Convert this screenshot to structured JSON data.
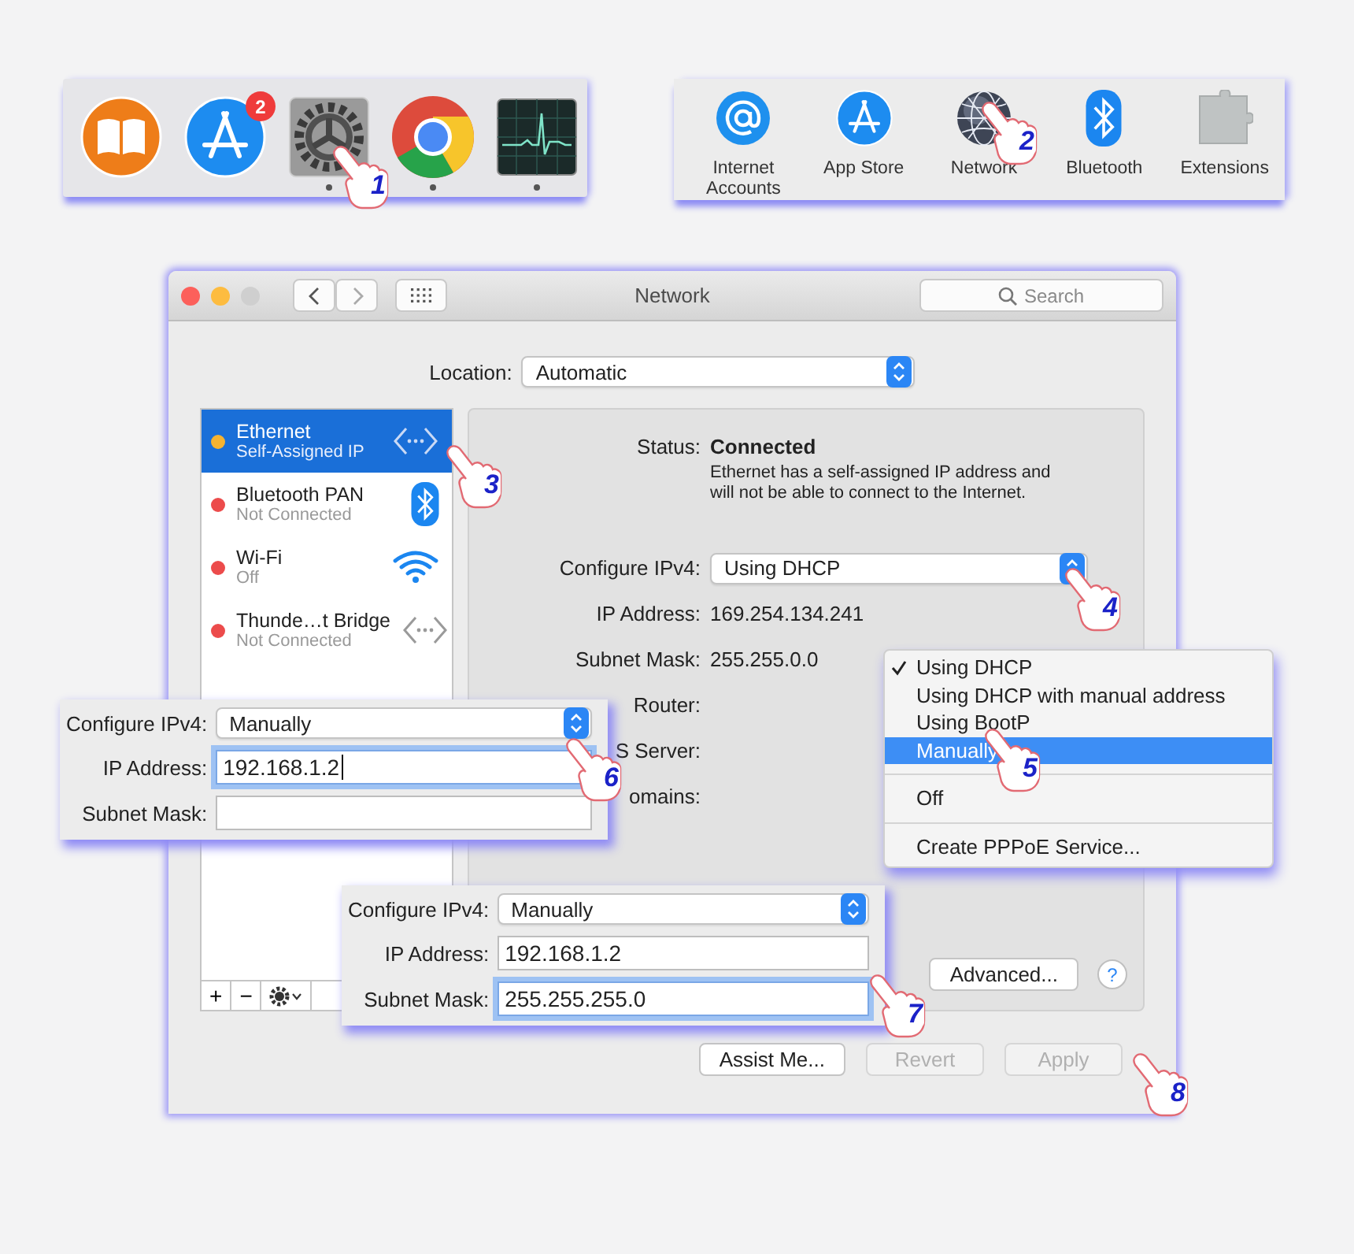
{
  "dock": {
    "items": [
      {
        "kind": "books"
      },
      {
        "kind": "store",
        "badge": "2"
      },
      {
        "kind": "settings",
        "running": true
      },
      {
        "kind": "browser",
        "running": true
      },
      {
        "kind": "monitor",
        "running": true
      }
    ]
  },
  "preferences": {
    "items": [
      {
        "kind": "accounts",
        "label": "Internet Accounts"
      },
      {
        "kind": "store",
        "label": "App Store"
      },
      {
        "kind": "network",
        "label": "Network"
      },
      {
        "kind": "bluetooth",
        "label": "Bluetooth"
      },
      {
        "kind": "extensions",
        "label": "Extensions"
      }
    ]
  },
  "window": {
    "title": "Network",
    "search": {
      "placeholder": "Search"
    },
    "location": {
      "label": "Location:",
      "value": "Automatic"
    }
  },
  "services": [
    {
      "name": "Ethernet",
      "status": "Self-Assigned IP",
      "color": "#f5b331",
      "kind": "ethernet",
      "selected": true
    },
    {
      "name": "Bluetooth PAN",
      "status": "Not Connected",
      "color": "#ec4b4b",
      "kind": "bluetooth",
      "selected": false
    },
    {
      "name": "Wi-Fi",
      "status": "Off",
      "color": "#ec4b4b",
      "kind": "wifi",
      "selected": false
    },
    {
      "name": "Thunde…t Bridge",
      "status": "Not Connected",
      "color": "#ec4b4b",
      "kind": "ethernet",
      "selected": false
    }
  ],
  "service_tools": {
    "add": "+",
    "remove": "−"
  },
  "details": {
    "status_label": "Status:",
    "status": "Connected",
    "description": "Ethernet has a self-assigned IP address and will not be able to connect to the Internet.",
    "fields": [
      {
        "kind": "popup",
        "label": "Configure IPv4:",
        "value": "Using DHCP"
      },
      {
        "kind": "text",
        "label": "IP Address:",
        "value": "169.254.134.241"
      },
      {
        "kind": "text",
        "label": "Subnet Mask:",
        "value": "255.255.0.0"
      },
      {
        "kind": "text",
        "label": "Router:"
      },
      {
        "kind": "text",
        "label": "S Server:"
      },
      {
        "kind": "text",
        "label": "omains:"
      }
    ],
    "advanced": "Advanced...",
    "help": "?"
  },
  "footer_buttons": [
    {
      "label": "Assist Me...",
      "disabled": false
    },
    {
      "label": "Revert",
      "disabled": true
    },
    {
      "label": "Apply",
      "disabled": true
    }
  ],
  "menu": {
    "items": [
      {
        "kind": "item",
        "label": "Using DHCP",
        "checked": true,
        "selected": false
      },
      {
        "kind": "item",
        "label": "Using DHCP with manual address",
        "checked": false,
        "selected": false
      },
      {
        "kind": "item",
        "label": "Using BootP",
        "checked": false,
        "selected": false
      },
      {
        "kind": "item",
        "label": "Manually",
        "checked": false,
        "selected": true
      },
      {
        "kind": "separator"
      },
      {
        "kind": "item",
        "label": "Off",
        "checked": false,
        "selected": false
      },
      {
        "kind": "separator"
      },
      {
        "kind": "item",
        "label": "Create PPPoE Service...",
        "checked": false,
        "selected": false
      }
    ]
  },
  "callouts": [
    {
      "fields": [
        {
          "kind": "popup",
          "label": "Configure IPv4:",
          "value": "Manually"
        },
        {
          "kind": "field",
          "label": "IP Address:",
          "value": "192.168.1.2",
          "focused": true
        },
        {
          "kind": "field",
          "label": "Subnet Mask:",
          "focused": false
        }
      ]
    },
    {
      "fields": [
        {
          "kind": "popup",
          "label": "Configure IPv4:",
          "value": "Manually"
        },
        {
          "kind": "field",
          "label": "IP Address:",
          "value": "192.168.1.2",
          "focused": false
        },
        {
          "kind": "field",
          "label": "Subnet Mask:",
          "value": "255.255.255.0",
          "focused": true
        }
      ]
    }
  ],
  "steps": [
    {
      "number": "1"
    },
    {
      "number": "2"
    },
    {
      "number": "3"
    },
    {
      "number": "4"
    },
    {
      "number": "5"
    },
    {
      "number": "6"
    },
    {
      "number": "7"
    },
    {
      "number": "8"
    }
  ]
}
